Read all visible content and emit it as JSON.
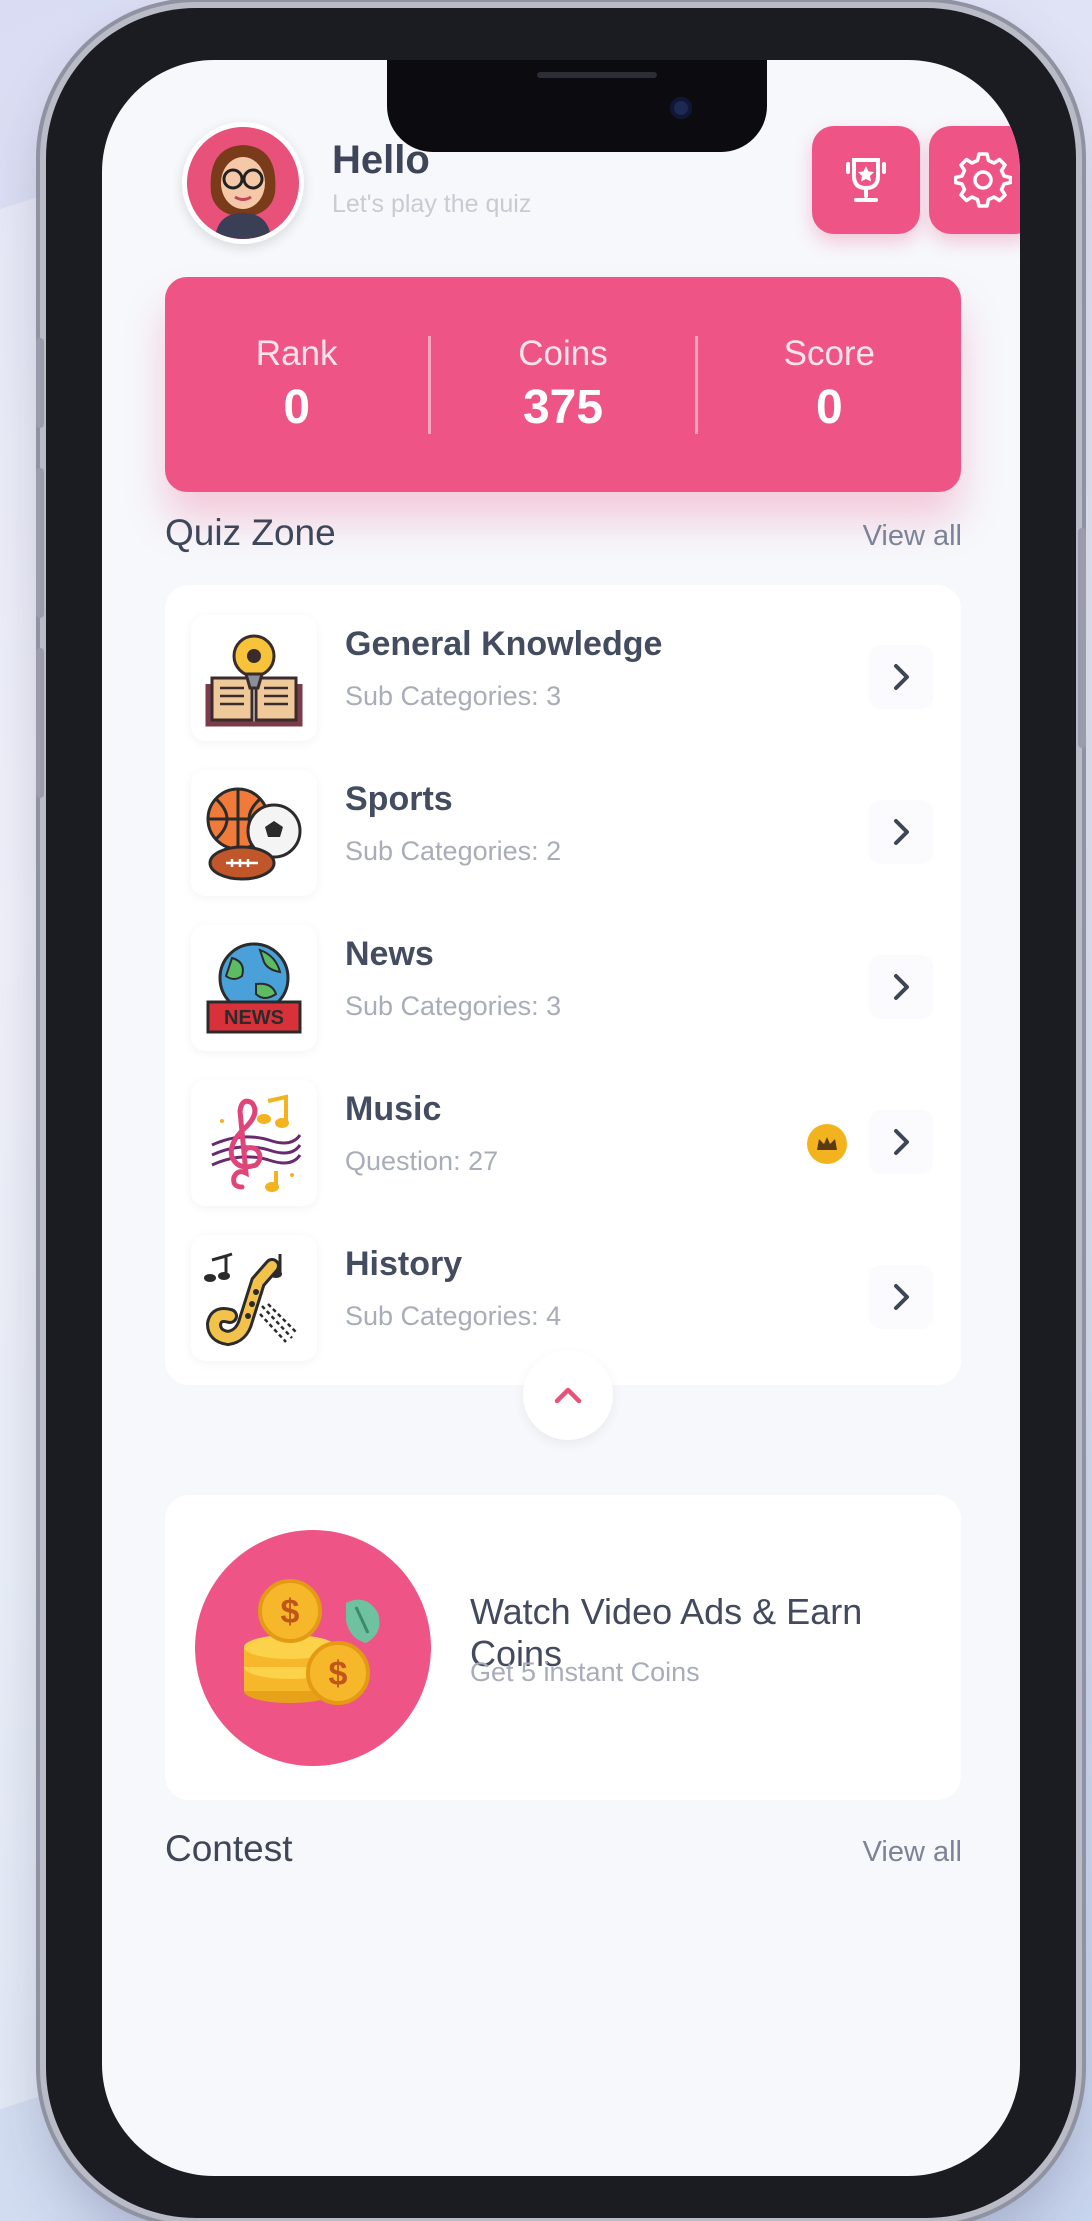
{
  "header": {
    "greeting": "Hello",
    "subtitle": "Let's play the quiz"
  },
  "stats": [
    {
      "label": "Rank",
      "value": "0"
    },
    {
      "label": "Coins",
      "value": "375"
    },
    {
      "label": "Score",
      "value": "0"
    }
  ],
  "quiz_zone": {
    "title": "Quiz Zone",
    "view_all": "View all",
    "items": [
      {
        "title": "General Knowledge",
        "subtitle": "Sub Categories: 3",
        "icon": "book-bulb-icon"
      },
      {
        "title": "Sports",
        "subtitle": "Sub Categories: 2",
        "icon": "sports-balls-icon"
      },
      {
        "title": "News",
        "subtitle": "Sub Categories: 3",
        "icon": "globe-news-icon",
        "icon_text": "NEWS"
      },
      {
        "title": "Music",
        "subtitle": "Question: 27",
        "icon": "music-notes-icon",
        "premium": true
      },
      {
        "title": "History",
        "subtitle": "Sub Categories: 4",
        "icon": "saxophone-icon"
      }
    ]
  },
  "ad": {
    "title": "Watch Video Ads & Earn Coins",
    "subtitle": "Get 5 instant Coins"
  },
  "contest": {
    "title": "Contest",
    "view_all": "View all"
  },
  "colors": {
    "accent": "#ee5586",
    "background": "#f6f8fc",
    "text": "#3f4658",
    "muted": "#a8adb9",
    "premium": "#f2b31f"
  }
}
